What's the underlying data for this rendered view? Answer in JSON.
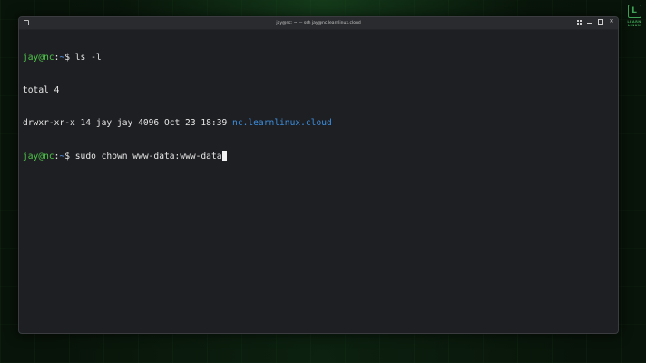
{
  "window": {
    "title": "jay@nc: ~ — ssh jay@nc.learnlinux.cloud"
  },
  "logo": {
    "glyph": "L",
    "text": "LEARN LINUX"
  },
  "terminal": {
    "lines": [
      {
        "user": "jay@nc",
        "sep": ":",
        "path": "~",
        "symbol": "$",
        "command": " ls -l"
      },
      {
        "text": "total 4"
      },
      {
        "text": "drwxr-xr-x 14 jay jay 4096 Oct 23 18:39 ",
        "highlight": "nc.learnlinux.cloud"
      },
      {
        "user": "jay@nc",
        "sep": ":",
        "path": "~",
        "symbol": "$",
        "command": " sudo chown www-data:www-data"
      }
    ]
  },
  "colors": {
    "prompt_user": "#4ec44a",
    "prompt_path": "#5c9cf5",
    "directory": "#3d8fe0",
    "terminal_bg": "#1e1f22",
    "text": "#e6e6e6"
  },
  "icons": [
    "terminal-icon",
    "grid-view-icon",
    "minimize-icon",
    "maximize-icon",
    "close-icon",
    "learn-linux-logo-icon"
  ]
}
